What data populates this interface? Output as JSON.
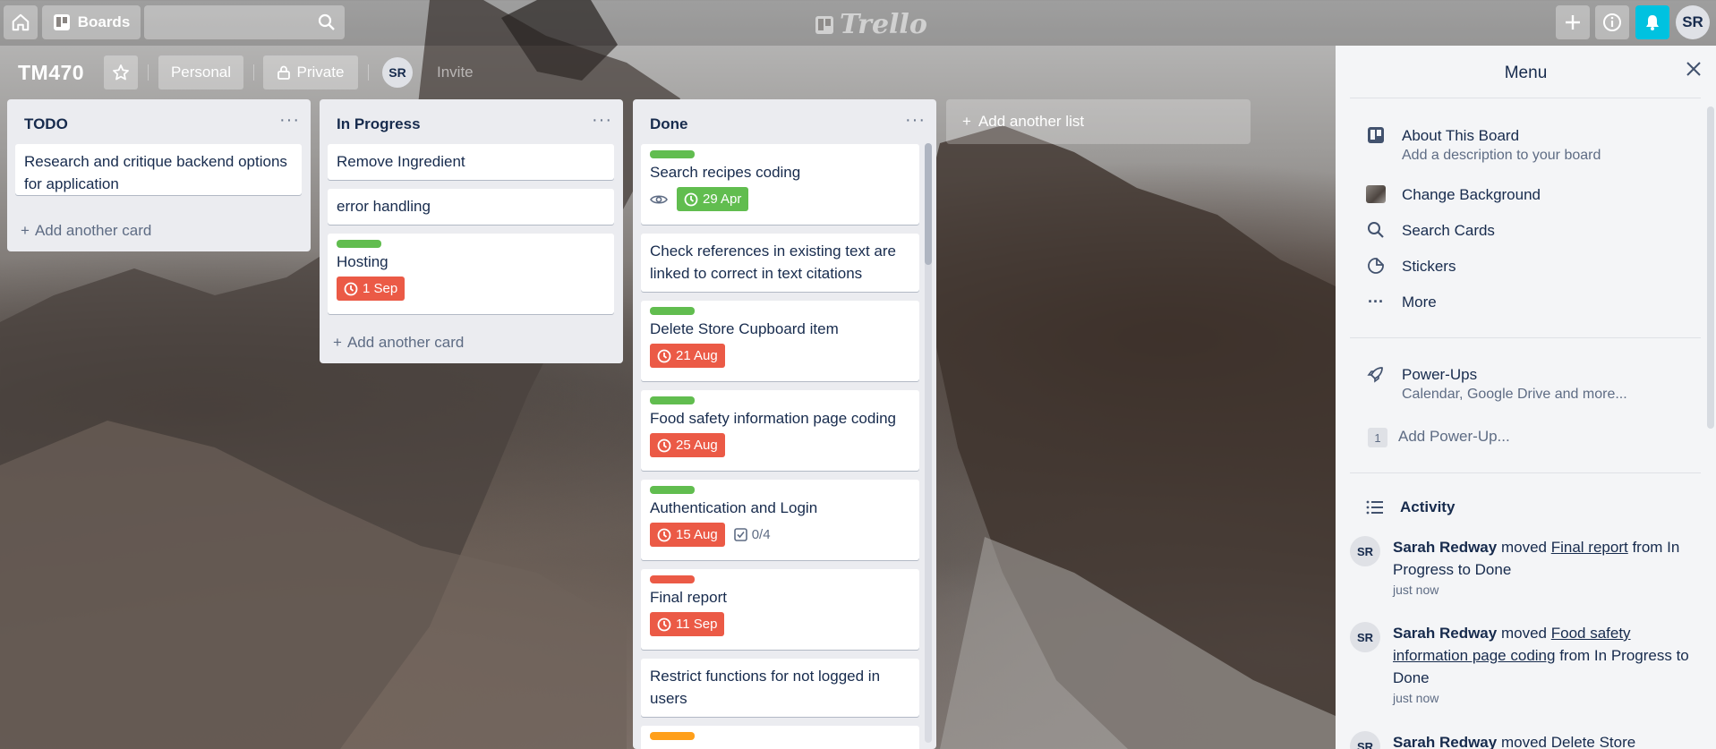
{
  "header": {
    "boards_label": "Boards",
    "logo_text": "Trello",
    "avatar_initials": "SR"
  },
  "board": {
    "title": "TM470",
    "team_label": "Personal",
    "visibility_label": "Private",
    "member_initials": "SR",
    "invite_label": "Invite"
  },
  "lists": [
    {
      "title": "TODO",
      "cards": [
        {
          "title": "Research and critique backend options for application"
        }
      ],
      "add_label": "Add another card"
    },
    {
      "title": "In Progress",
      "cards": [
        {
          "title": "Remove Ingredient"
        },
        {
          "title": "error handling"
        },
        {
          "title": "Hosting",
          "label_color": "#61bd4f",
          "due": "1 Sep",
          "due_color": "#eb5a46"
        }
      ],
      "add_label": "Add another card"
    },
    {
      "title": "Done",
      "cards": [
        {
          "title": "Search recipes coding",
          "label_color": "#61bd4f",
          "due": "29 Apr",
          "due_color": "#61bd4f",
          "watching": true
        },
        {
          "title": "Check references in existing text are linked to correct in text citations"
        },
        {
          "title": "Delete Store Cupboard item",
          "label_color": "#61bd4f",
          "due": "21 Aug",
          "due_color": "#eb5a46"
        },
        {
          "title": "Food safety information page coding",
          "label_color": "#61bd4f",
          "due": "25 Aug",
          "due_color": "#eb5a46"
        },
        {
          "title": "Authentication and Login",
          "label_color": "#61bd4f",
          "due": "15 Aug",
          "due_color": "#eb5a46",
          "checklist": "0/4"
        },
        {
          "title": "Final report",
          "label_color": "#eb5a46",
          "due": "11 Sep",
          "due_color": "#eb5a46"
        },
        {
          "title": "Restrict functions for not logged in users"
        },
        {
          "label_color": "#ff9f1a"
        }
      ]
    }
  ],
  "add_list_label": "Add another list",
  "menu": {
    "title": "Menu",
    "about": {
      "title": "About This Board",
      "subtitle": "Add a description to your board"
    },
    "change_background": "Change Background",
    "search_cards": "Search Cards",
    "stickers": "Stickers",
    "more": "More",
    "power_ups": {
      "title": "Power-Ups",
      "subtitle": "Calendar, Google Drive and more...",
      "count": "1",
      "add_label": "Add Power-Up..."
    },
    "activity": {
      "title": "Activity",
      "items": [
        {
          "initials": "SR",
          "user": "Sarah Redway",
          "action": "moved",
          "card": "Final report",
          "rest": "from In Progress to Done",
          "time": "just now"
        },
        {
          "initials": "SR",
          "user": "Sarah Redway",
          "action": "moved",
          "card": "Food safety information page coding",
          "rest": "from In Progress to Done",
          "time": "just now"
        },
        {
          "initials": "SR",
          "user": "Sarah Redway",
          "action": "moved Delete Store",
          "card": "",
          "rest": "",
          "time": ""
        }
      ]
    }
  }
}
